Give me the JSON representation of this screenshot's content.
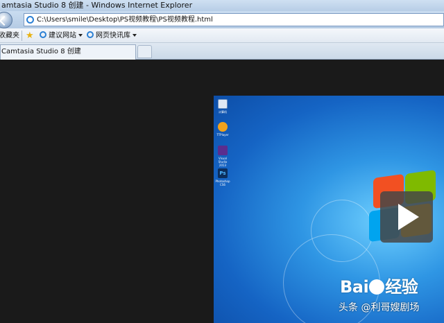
{
  "window": {
    "title": "amtasia Studio 8 创建 - Windows Internet Explorer"
  },
  "address_bar": {
    "url": "C:\\Users\\smile\\Desktop\\PS视频教程\\PS视频教程.html"
  },
  "favorites_bar": {
    "favorites_label": "收藏夹",
    "items": [
      {
        "label": "建议网站",
        "icon": "ie-page-icon"
      },
      {
        "label": "网页快讯库",
        "icon": "ie-page-icon"
      }
    ]
  },
  "tabs": [
    {
      "label": "Camtasia Studio 8 创建"
    }
  ],
  "desktop_icons": [
    {
      "label": "计算机",
      "icon": "computer-icon"
    },
    {
      "label": "TTPlayer",
      "icon": "player-icon"
    },
    {
      "label": "Visual Studio 2013",
      "icon": "vs-icon"
    },
    {
      "label": "Photoshop CS6",
      "icon": "photoshop-icon",
      "glyph": "Ps"
    }
  ],
  "overlay": {
    "baidu_logo_text": "Bai",
    "baidu_logo_text2": "经验",
    "watermark": "头条 @利哥嫂剧场"
  },
  "colors": {
    "accent": "#2a7fd4",
    "desktop_blue": "#1564c4",
    "dark_bg": "#1a1a1a"
  }
}
